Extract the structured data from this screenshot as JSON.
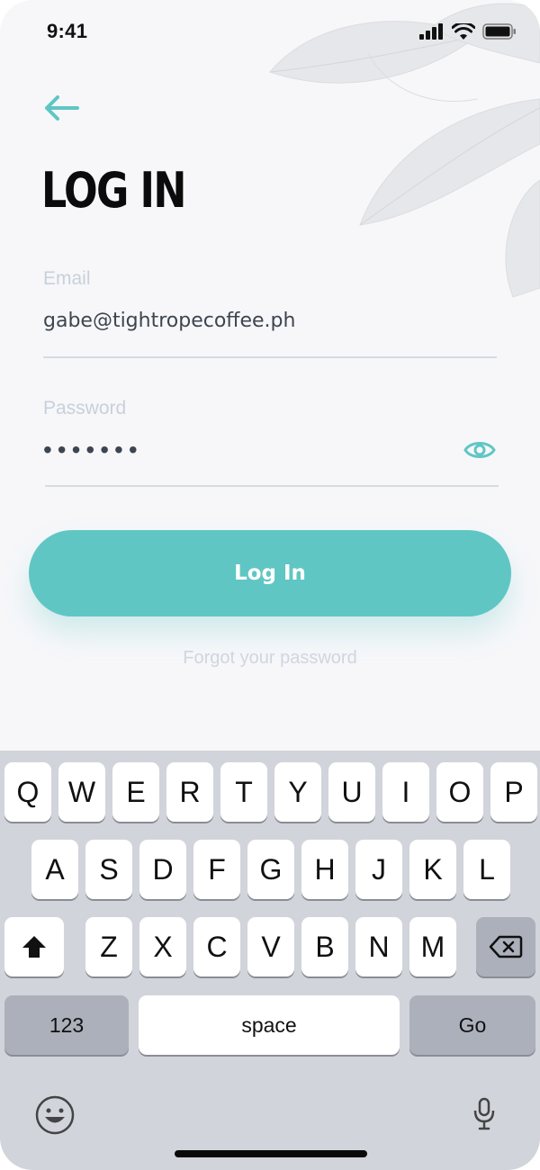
{
  "status_bar": {
    "time": "9:41"
  },
  "page": {
    "title": "LOG IN"
  },
  "form": {
    "email_label": "Email",
    "email_value": "gabe@tightropecoffee.ph",
    "password_label": "Password",
    "password_masked": "•••••••"
  },
  "actions": {
    "login_label": "Log In",
    "forgot_label": "Forgot your password"
  },
  "keyboard": {
    "row1": [
      "Q",
      "W",
      "E",
      "R",
      "T",
      "Y",
      "U",
      "I",
      "O",
      "P"
    ],
    "row2": [
      "A",
      "S",
      "D",
      "F",
      "G",
      "H",
      "J",
      "K",
      "L"
    ],
    "row3": [
      "Z",
      "X",
      "C",
      "V",
      "B",
      "N",
      "M"
    ],
    "numbers_label": "123",
    "space_label": "space",
    "go_label": "Go"
  },
  "colors": {
    "accent": "#60c6c4",
    "background": "#f7f7fa",
    "keyboard_bg": "#d1d4da",
    "label": "#c8d0da"
  },
  "icons": {
    "back": "arrow-left-icon",
    "eye": "eye-icon",
    "shift": "shift-icon",
    "delete": "backspace-icon",
    "emoji": "emoji-icon",
    "dictation": "microphone-icon"
  }
}
